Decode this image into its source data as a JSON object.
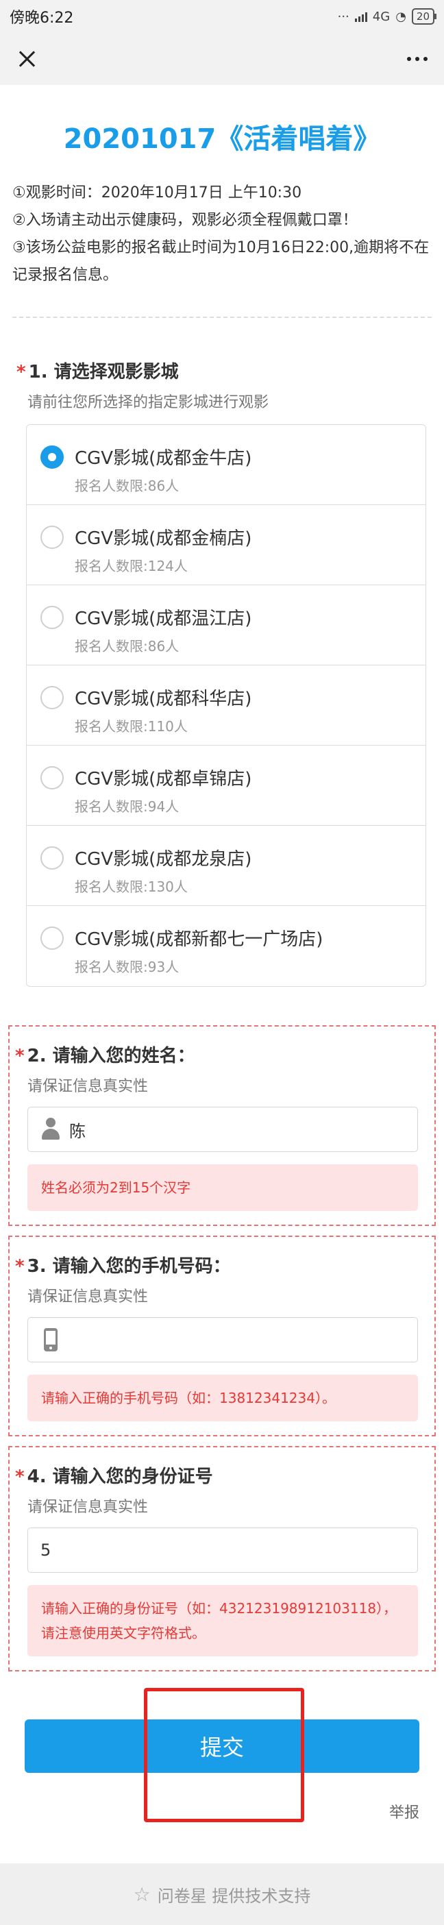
{
  "status_bar": {
    "time": "傍晚6:22",
    "network": "4G",
    "battery": "20"
  },
  "page": {
    "title": "20201017《活着唱着》",
    "description": [
      "①观影时间：2020年10月17日 上午10:30",
      "②入场请主动出示健康码，观影必须全程佩戴口罩！",
      "③该场公益电影的报名截止时间为10月16日22:00,逾期将不在记录报名信息。"
    ]
  },
  "q1": {
    "required": "*",
    "title": "1. 请选择观影影城",
    "subtitle": "请前往您所选择的指定影城进行观影",
    "options": [
      {
        "label": "CGV影城(成都金牛店)",
        "sub": "报名人数限:86人",
        "checked": true
      },
      {
        "label": "CGV影城(成都金楠店)",
        "sub": "报名人数限:124人",
        "checked": false
      },
      {
        "label": "CGV影城(成都温江店)",
        "sub": "报名人数限:86人",
        "checked": false
      },
      {
        "label": "CGV影城(成都科华店)",
        "sub": "报名人数限:110人",
        "checked": false
      },
      {
        "label": "CGV影城(成都卓锦店)",
        "sub": "报名人数限:94人",
        "checked": false
      },
      {
        "label": "CGV影城(成都龙泉店)",
        "sub": "报名人数限:130人",
        "checked": false
      },
      {
        "label": "CGV影城(成都新都七一广场店)",
        "sub": "报名人数限:93人",
        "checked": false
      }
    ]
  },
  "q2": {
    "required": "*",
    "title": "2. 请输入您的姓名：",
    "subtitle": "请保证信息真实性",
    "value": "陈",
    "error": "姓名必须为2到15个汉字"
  },
  "q3": {
    "required": "*",
    "title": "3. 请输入您的手机号码：",
    "subtitle": "请保证信息真实性",
    "value": "",
    "error": "请输入正确的手机号码（如：13812341234）。"
  },
  "q4": {
    "required": "*",
    "title": "4. 请输入您的身份证号",
    "subtitle": "请保证信息真实性",
    "value": "5",
    "error": "请输入正确的身份证号（如：432123198912103118），请注意使用英文字符格式。"
  },
  "actions": {
    "submit_label": "提交",
    "report_label": "举报"
  },
  "footer": {
    "text": "问卷星 提供技术支持"
  },
  "colors": {
    "accent": "#1a9de8",
    "error": "#e53935",
    "highlight": "#e8231d"
  }
}
